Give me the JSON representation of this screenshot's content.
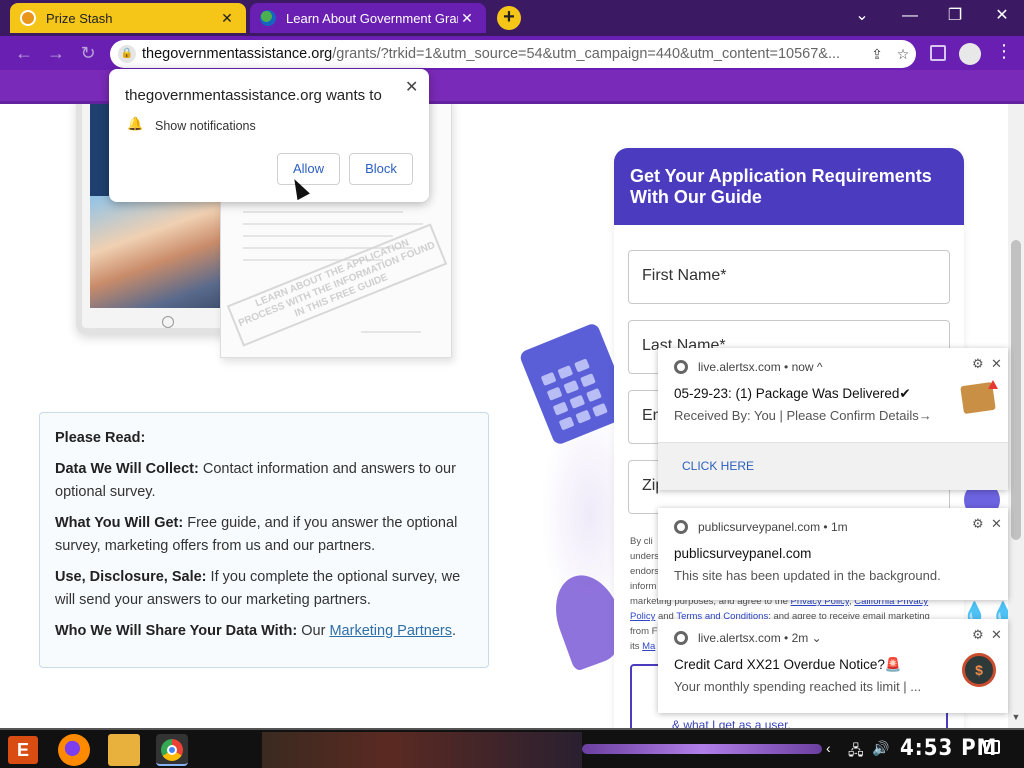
{
  "browser": {
    "tabs": [
      {
        "title": "Prize Stash",
        "active": false
      },
      {
        "title": "Learn About Government Grant",
        "active": true
      }
    ],
    "new_tab_icon": "plus-icon",
    "url_domain": "thegovernmentassistance.org",
    "url_rest": "/grants/?trkid=1&utm_source=54&utm_campaign=440&utm_content=10567&..."
  },
  "permission_prompt": {
    "title": "thegovernmentassistance.org wants to",
    "message": "Show notifications",
    "allow_label": "Allow",
    "block_label": "Block"
  },
  "hero": {
    "stamp_text": "LEARN ABOUT THE APPLICATION PROCESS WITH THE INFORMATION FOUND IN THIS FREE GUIDE"
  },
  "read_box": {
    "heading": "Please Read:",
    "items": [
      {
        "label": "Data We Will Collect:",
        "text": "Contact information and answers to our optional survey."
      },
      {
        "label": "What You Will Get:",
        "text": "Free guide, and if you answer the optional survey, marketing offers from us and our partners."
      },
      {
        "label": "Use, Disclosure, Sale:",
        "text": "If you complete the optional survey, we will send your answers to our marketing partners."
      },
      {
        "label": "Who We Will Share Your Data With:",
        "text": "Our",
        "link": "Marketing Partners",
        "after": "."
      }
    ]
  },
  "form": {
    "title": "Get Your Application Requirements With Our Guide",
    "fields": [
      "First Name*",
      "Last Name*",
      "Em",
      "Zip Code"
    ],
    "legal_lines": [
      "By cli",
      "unders",
      "endors",
      "inform",
      "marketing purposes, and agree to the",
      "Policy",
      "and",
      "from F",
      "its"
    ],
    "links": {
      "privacy": "Privacy Policy",
      "california": "California Privacy",
      "terms": "Terms and Conditions",
      "ma": "Ma"
    },
    "legal_tail": ": and agree to receive email marketing",
    "consent_tail": "& what I get as a user."
  },
  "notifications": [
    {
      "source": "live.alertsx.com",
      "time": "now",
      "chevron": "^",
      "title": "05-29-23: (1) Package Was Delivered✔",
      "subtitle": "Received By: You | Please Confirm Details→",
      "action": "CLICK HERE",
      "icon": "package-icon"
    },
    {
      "source": "publicsurveypanel.com",
      "time": "1m",
      "title": "publicsurveypanel.com",
      "subtitle": "This site has been updated in the background."
    },
    {
      "source": "live.alertsx.com",
      "time": "2m",
      "chevron": "⌄",
      "title": "Credit Card XX21 Overdue Notice?🚨",
      "subtitle": "Your monthly spending reached its limit | ...",
      "icon": "dollar-coin-icon"
    }
  ],
  "taskbar": {
    "clock": "4:53 PM"
  },
  "colors": {
    "tab_strip": "#3b1a63",
    "toolbar": "#6a1fb3",
    "form_header": "#4b3bbf",
    "link": "#2f6fa8"
  }
}
